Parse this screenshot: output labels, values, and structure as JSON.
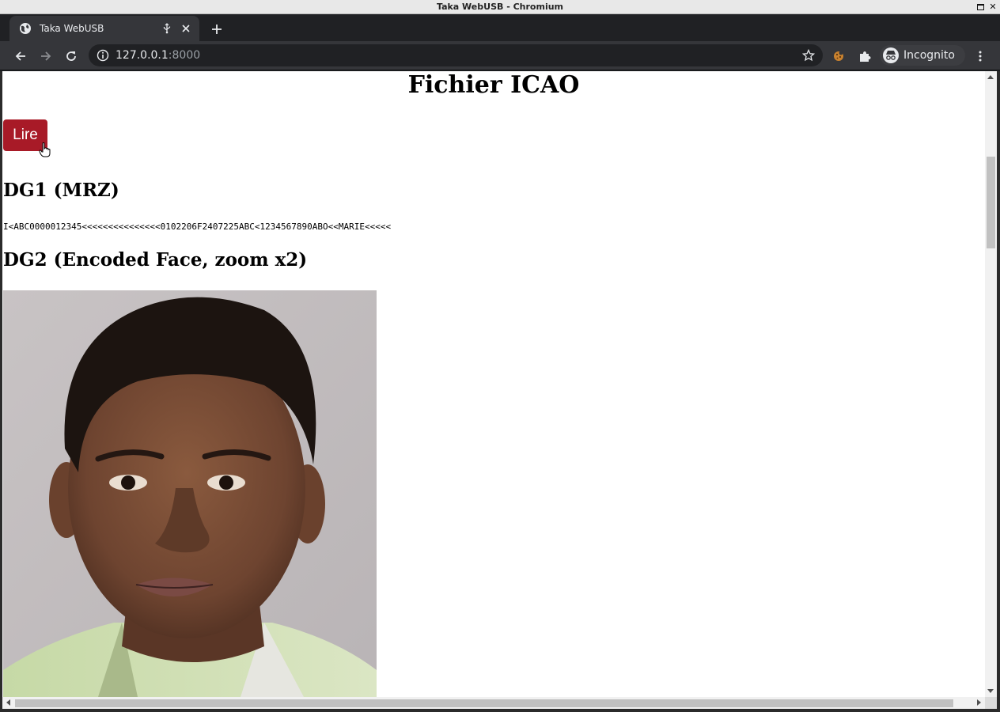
{
  "window": {
    "title": "Taka WebUSB - Chromium"
  },
  "tab": {
    "title": "Taka WebUSB"
  },
  "toolbar": {
    "url_host": "127.0.0.1",
    "url_port": ":8000",
    "profile_label": "Incognito"
  },
  "page": {
    "title": "Fichier ICAO",
    "read_button_label": "Lire",
    "dg1_heading": "DG1 (MRZ)",
    "mrz_text": "I<ABC0000012345<<<<<<<<<<<<<<<0102206F2407225ABC<1234567890ABO<<MARIE<<<<<",
    "dg2_heading": "DG2 (Encoded Face, zoom x2)"
  },
  "colors": {
    "button_bg": "#a81a27",
    "chrome_dark": "#35363a",
    "tabstrip": "#202124"
  },
  "icons": [
    "globe-icon",
    "usb-icon",
    "close-icon",
    "new-tab-icon",
    "back-icon",
    "forward-icon",
    "reload-icon",
    "info-icon",
    "star-icon",
    "extension-cookie-icon",
    "puzzle-icon",
    "incognito-icon",
    "menu-icon"
  ]
}
